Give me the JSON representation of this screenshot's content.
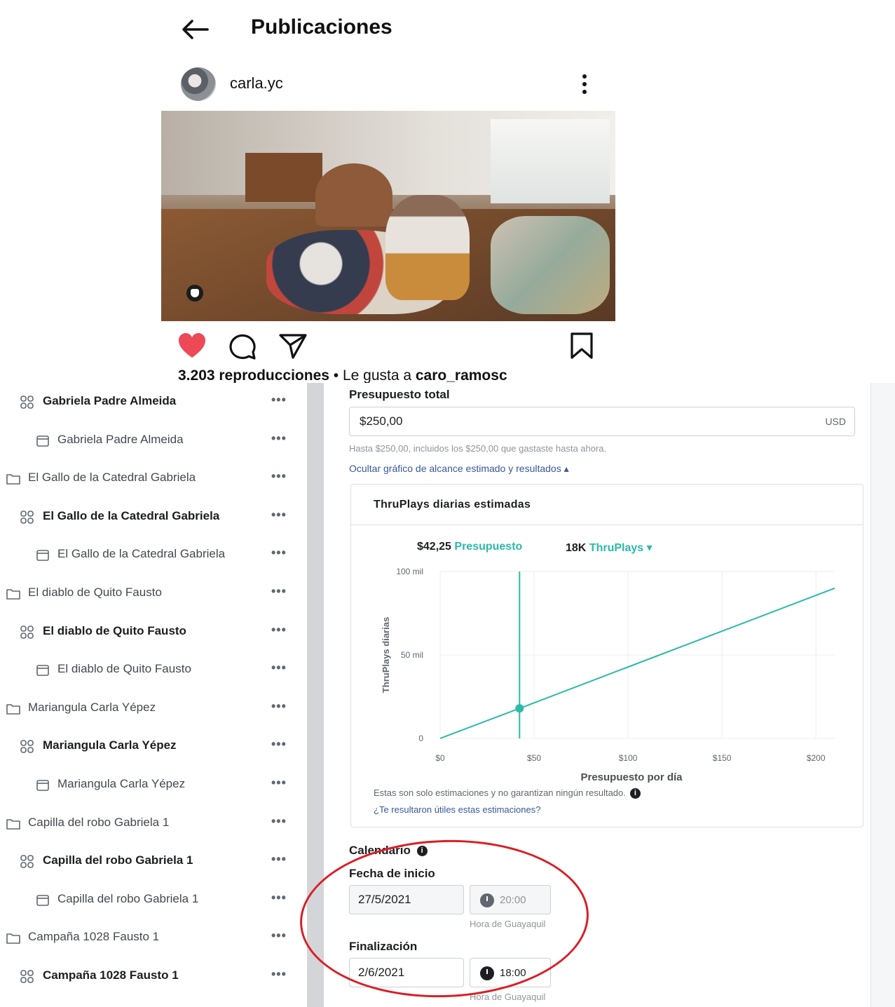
{
  "instagram": {
    "title": "Publicaciones",
    "username": "carla.yc",
    "views": "3.203 reproducciones",
    "liked_by_prefix": " • Le gusta a ",
    "liked_by_user": "caro_ramosc",
    "icons": [
      "back-arrow-icon",
      "more-vertical-icon",
      "heart-icon",
      "comment-icon",
      "share-icon",
      "bookmark-icon",
      "mute-icon"
    ],
    "colors": {
      "heart": "#ed4956"
    }
  },
  "tree": {
    "items": [
      {
        "type": "adset",
        "label": "Gabriela Padre Almeida",
        "more": "•••"
      },
      {
        "type": "ad",
        "label": "Gabriela Padre Almeida",
        "more": "•••"
      },
      {
        "type": "campaign",
        "label": "El Gallo de la Catedral Gabriela",
        "more": "•••"
      },
      {
        "type": "adset",
        "label": "El Gallo de la Catedral Gabriela",
        "more": "•••"
      },
      {
        "type": "ad",
        "label": "El Gallo de la Catedral Gabriela",
        "more": "•••"
      },
      {
        "type": "campaign",
        "label": "El diablo de Quito Fausto",
        "more": "•••"
      },
      {
        "type": "adset",
        "label": "El diablo de Quito Fausto",
        "more": "•••"
      },
      {
        "type": "ad",
        "label": "El diablo de Quito Fausto",
        "more": "•••"
      },
      {
        "type": "campaign",
        "label": "Mariangula Carla Yépez",
        "more": "•••"
      },
      {
        "type": "adset",
        "label": "Mariangula Carla Yépez",
        "more": "•••"
      },
      {
        "type": "ad",
        "label": "Mariangula Carla Yépez",
        "more": "•••"
      },
      {
        "type": "campaign",
        "label": "Capilla del robo Gabriela 1",
        "more": "•••"
      },
      {
        "type": "adset",
        "label": "Capilla del robo Gabriela 1",
        "more": "•••"
      },
      {
        "type": "ad",
        "label": "Capilla del robo Gabriela 1",
        "more": "•••"
      },
      {
        "type": "campaign",
        "label": "Campaña 1028 Fausto 1",
        "more": "•••"
      },
      {
        "type": "adset",
        "label": "Campaña 1028 Fausto 1",
        "more": "•••"
      }
    ]
  },
  "budget": {
    "label": "Presupuesto total",
    "value": "$250,00",
    "currency": "USD",
    "hint": "Hasta $250,00, incluidos los $250,00 que gastaste hasta ahora.",
    "toggle_link": "Ocultar gráfico de alcance estimado y resultados ▴"
  },
  "estimate_card": {
    "title": "ThruPlays diarias estimadas",
    "budget_value": "$42,25",
    "budget_label": "Presupuesto",
    "result_value": "18K",
    "result_label": "ThruPlays ▾",
    "disclaimer": "Estas son solo estimaciones y no garantizan ningún resultado.",
    "info": "i",
    "feedback_link": "¿Te resultaron útiles estas estimaciones?"
  },
  "chart_data": {
    "type": "line",
    "xlabel": "Presupuesto por día",
    "ylabel": "ThruPlays diarias",
    "xlim": [
      0,
      210
    ],
    "ylim": [
      0,
      100000
    ],
    "x_ticks": [
      "$0",
      "$50",
      "$100",
      "$150",
      "$200"
    ],
    "x_tick_values": [
      0,
      50,
      100,
      150,
      200
    ],
    "y_ticks": [
      "0",
      "50 mil",
      "100 mil"
    ],
    "y_tick_values": [
      0,
      50000,
      100000
    ],
    "grid": true,
    "series": [
      {
        "x": [
          0,
          42.25,
          210
        ],
        "y": [
          0,
          18000,
          90000
        ]
      }
    ],
    "marker": {
      "x": 42.25,
      "y": 18000
    },
    "colors": {
      "line": "#2abba7",
      "grid": "#ebedf0"
    }
  },
  "schedule": {
    "label": "Calendario",
    "start_label": "Fecha de inicio",
    "start_date": "27/5/2021",
    "start_time": "20:00",
    "end_label": "Finalización",
    "end_date": "2/6/2021",
    "end_time": "18:00",
    "timezone": "Hora de Guayaquil"
  },
  "annotation": {
    "color": "#d91f26"
  }
}
